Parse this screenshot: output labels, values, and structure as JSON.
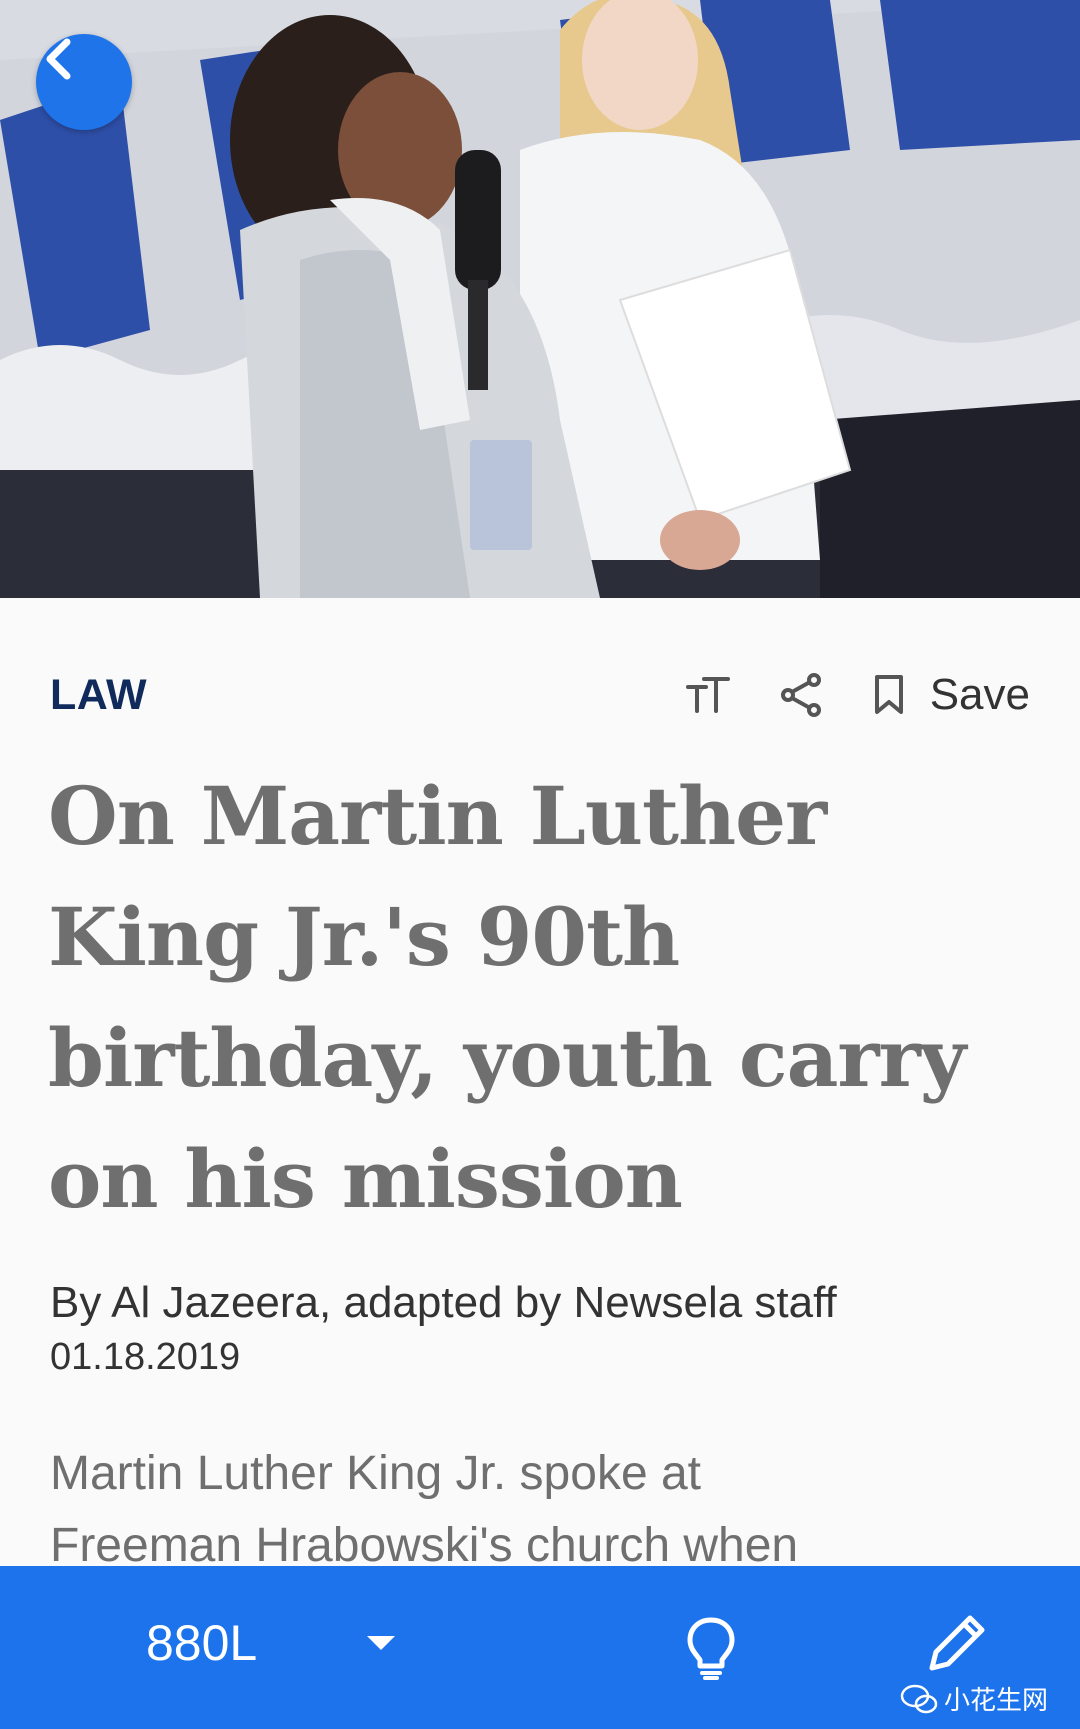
{
  "hero": {
    "image_description_icon": "photo-two-girls-with-microphone"
  },
  "header": {
    "back_icon": "chevron-left-icon"
  },
  "article": {
    "category": "LAW",
    "actions": {
      "text_size_icon": "text-size-icon",
      "share_icon": "share-icon",
      "bookmark_icon": "bookmark-icon",
      "save_label": "Save"
    },
    "title": "On Martin Luther King Jr.'s 90th birthday, youth carry on his mission",
    "byline": "By Al Jazeera, adapted by Newsela staff",
    "date": "01.18.2019",
    "body_lines": [
      "Martin Luther King Jr. spoke at",
      "Freeman Hrabowski's church when"
    ]
  },
  "bottom_bar": {
    "reading_level": "880L",
    "dropdown_icon": "caret-down-icon",
    "hint_icon": "lightbulb-icon",
    "write_icon": "pencil-icon",
    "watermark": "小花生网"
  },
  "colors": {
    "accent": "#1d73ec",
    "category": "#102a5c",
    "title": "#6f6f6f",
    "text": "#333333"
  }
}
